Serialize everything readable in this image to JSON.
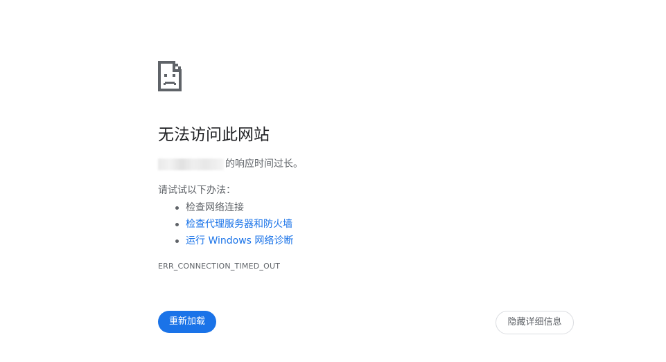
{
  "error_page": {
    "icon": "sad-document-icon",
    "title": "无法访问此网站",
    "summary_text": "的响应时间过长。",
    "suggestions_heading": "请试试以下办法：",
    "suggestions": [
      {
        "label": "检查网络连接",
        "link": false
      },
      {
        "label": "检查代理服务器和防火墙",
        "link": true
      },
      {
        "label": "运行 Windows 网络诊断",
        "link": true
      }
    ],
    "error_code": "ERR_CONNECTION_TIMED_OUT",
    "reload_label": "重新加载",
    "details_label": "隐藏详细信息"
  },
  "colors": {
    "accent": "#1a73e8",
    "text_primary": "#202124",
    "text_secondary": "#5f6368",
    "border": "#dadce0"
  }
}
